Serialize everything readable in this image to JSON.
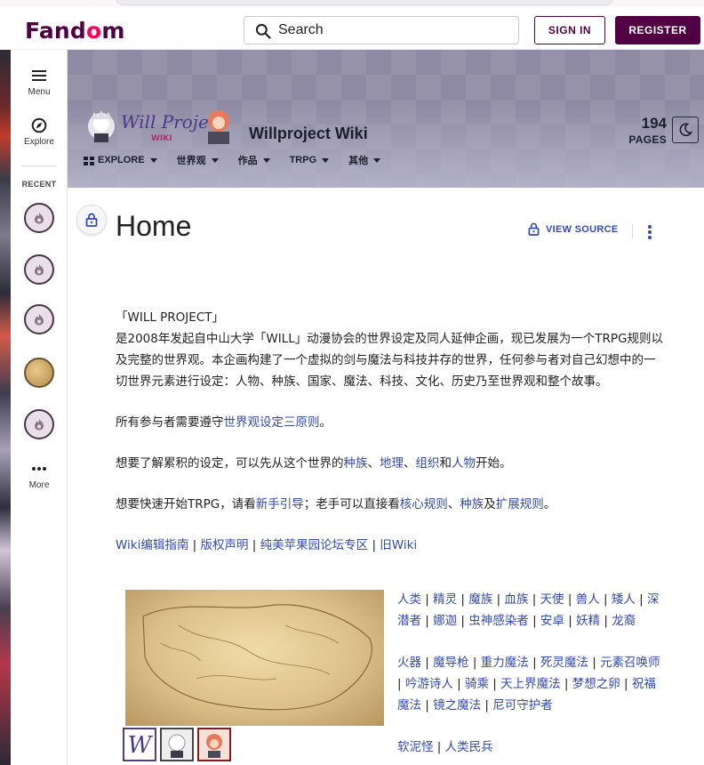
{
  "global_nav": {
    "logo": "Fandom",
    "search_placeholder": "Search",
    "sign_in": "SIGN IN",
    "register": "REGISTER"
  },
  "sidebar": {
    "menu": "Menu",
    "explore": "Explore",
    "recent": "RECENT",
    "more": "More"
  },
  "wiki": {
    "name": "Willproject Wiki",
    "pages_count": "194",
    "pages_label": "PAGES",
    "nav": [
      "EXPLORE",
      "世界观",
      "作品",
      "TRPG",
      "其他"
    ]
  },
  "page": {
    "title": "Home",
    "view_source": "VIEW SOURCE"
  },
  "content": {
    "heading": "「WILL PROJECT」",
    "intro": "是2008年发起自中山大学「WILL」动漫协会的世界设定及同人延伸企画，现已发展为一个TRPG规则以及完整的世界观。本企画构建了一个虚拟的剑与魔法与科技并存的世界，任何参与者对自己幻想中的一切世界元素进行设定：人物、种族、国家、魔法、科技、文化、历史乃至世界观和整个故事。",
    "rule_pre": "所有参与者需要遵守",
    "rule_link": "世界观设定三原则",
    "rule_post": "。",
    "learn_pre": "想要了解累积的设定，可以先从这个世界的",
    "learn_links": [
      "种族",
      "地理",
      "组织",
      "人物"
    ],
    "learn_sep1": "、",
    "learn_and": "和",
    "learn_post": "开始。",
    "trpg_pre": "想要快速开始TRPG，请看",
    "trpg_link1": "新手引导",
    "trpg_mid": "；老手可以直接看",
    "trpg_link2": "核心规则",
    "trpg_sep": "、",
    "trpg_link3": "种族",
    "trpg_and": "及",
    "trpg_link4": "扩展规则",
    "trpg_post": "。",
    "footer_links": [
      "Wiki编辑指南",
      "版权声明",
      "纯美苹果园论坛专区",
      "旧Wiki"
    ]
  },
  "link_groups": [
    [
      "人类",
      "精灵",
      "魔族",
      "血族",
      "天使",
      "兽人",
      "矮人",
      "深潜者",
      "娜迦",
      "虫神感染者",
      "安卓",
      "妖精",
      "龙裔"
    ],
    [
      "火器",
      "魔导枪",
      "重力魔法",
      "死灵魔法",
      "元素召唤师",
      "吟游诗人",
      "骑乘",
      "天上界魔法",
      "梦想之卵",
      "祝福魔法",
      "镜之魔法",
      "尼可守护者"
    ],
    [
      "软泥怪",
      "人类民兵"
    ]
  ],
  "colors": {
    "brand": "#520044",
    "link": "#334bb0",
    "header_bg": "#8e8aa4"
  }
}
